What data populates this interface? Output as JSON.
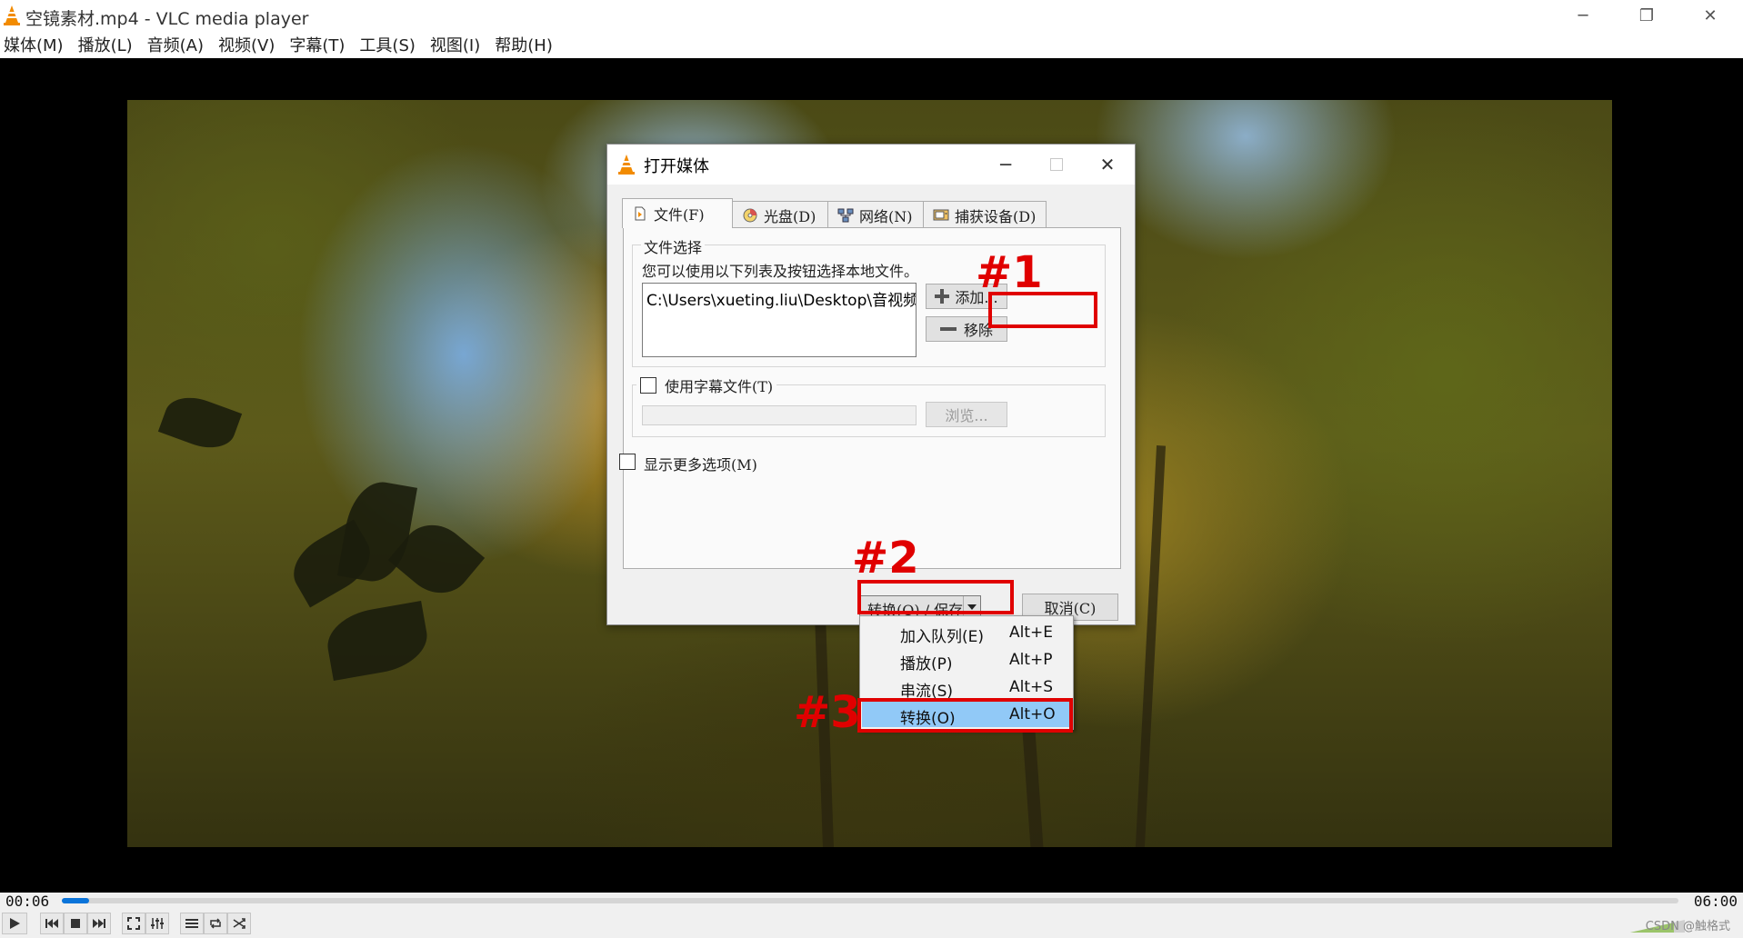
{
  "window": {
    "title": "空镜素材.mp4 - VLC media player",
    "minimize_glyph": "─",
    "maximize_glyph": "❐",
    "close_glyph": "✕"
  },
  "menu": [
    "媒体(M)",
    "播放(L)",
    "音频(A)",
    "视频(V)",
    "字幕(T)",
    "工具(S)",
    "视图(I)",
    "帮助(H)"
  ],
  "dialog": {
    "title": "打开媒体",
    "tabs": [
      {
        "label": "文件(F)",
        "icon": "file-icon"
      },
      {
        "label": "光盘(D)",
        "icon": "disc-icon"
      },
      {
        "label": "网络(N)",
        "icon": "network-icon"
      },
      {
        "label": "捕获设备(D)",
        "icon": "capture-device-icon"
      }
    ],
    "file_group_title": "文件选择",
    "file_hint": "您可以使用以下列表及按钮选择本地文件。",
    "file_entry": "C:\\Users\\xueting.liu\\Desktop\\音视频文件...",
    "add_button": "添加...",
    "remove_button": "移除",
    "subtitle_checkbox_label": "使用字幕文件(T)",
    "subtitle_checked": false,
    "browse_button": "浏览...",
    "more_options_label": "显示更多选项(M)",
    "more_options_checked": false,
    "convert_save_label": "转换(O) / 保存",
    "cancel_button": "取消(C)"
  },
  "dropdown": [
    {
      "label": "加入队列(E)",
      "shortcut": "Alt+E",
      "highlighted": false
    },
    {
      "label": "播放(P)",
      "shortcut": "Alt+P",
      "highlighted": false
    },
    {
      "label": "串流(S)",
      "shortcut": "Alt+S",
      "highlighted": false
    },
    {
      "label": "转换(O)",
      "shortcut": "Alt+O",
      "highlighted": true
    }
  ],
  "annotations": {
    "step1": "#1",
    "step2": "#2",
    "step3": "#3",
    "color": "#e00000"
  },
  "player": {
    "elapsed": "00:06",
    "total": "06:00",
    "progress_fraction": 0.017,
    "watermark": "CSDN @触格式"
  },
  "colors": {
    "accent_blue": "#0a74da",
    "menu_highlight": "#91c9f7",
    "vlc_orange": "#f28b00"
  }
}
